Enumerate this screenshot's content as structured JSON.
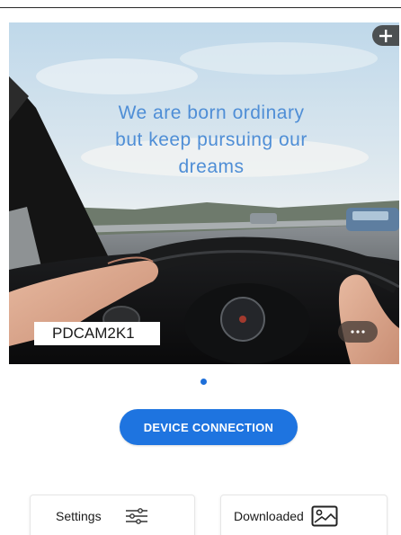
{
  "hero": {
    "slogan_lines": [
      "We are born ordinary",
      "but keep pursuing our",
      "dreams"
    ],
    "device_name": "PDCAM2K1",
    "add_icon": "plus-icon",
    "more_icon": "more-horizontal-icon"
  },
  "pager": {
    "current_page": 1,
    "total_pages": 1
  },
  "actions": {
    "connect_label": "DEVICE CONNECTION"
  },
  "bottom_cards": {
    "settings_label": "Settings",
    "settings_icon": "sliders-icon",
    "downloaded_label": "Downloaded",
    "downloaded_icon": "image-gallery-icon"
  },
  "colors": {
    "accent": "#1e74e0",
    "slogan": "#4f8ed6"
  }
}
